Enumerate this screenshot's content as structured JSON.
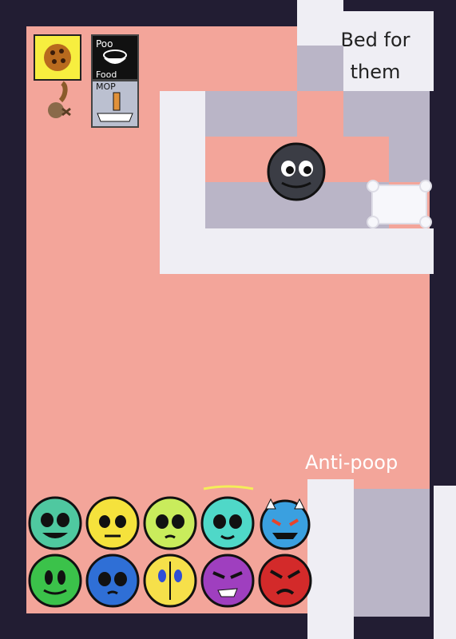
{
  "labels": {
    "bed": "Bed for them",
    "anti_poop": "Anti-poop"
  },
  "inventory": {
    "items": [
      {
        "name": "cookie",
        "icon": "cookie-icon",
        "selected": true
      },
      {
        "name": "poo food",
        "icon": "poo-food-icon",
        "text": "Poo Food"
      },
      {
        "name": "rope",
        "icon": "rope-icon"
      },
      {
        "name": "mop",
        "icon": "mop-icon",
        "text": "MOP"
      }
    ]
  },
  "characters": {
    "main": {
      "icon": "black-blob-character-icon"
    },
    "roster": [
      {
        "icon": "teal-happy-face-icon",
        "color": "#4fc8a0"
      },
      {
        "icon": "yellow-worried-face-icon",
        "color": "#f5e23c"
      },
      {
        "icon": "lime-pleading-face-icon",
        "color": "#c9ec5c"
      },
      {
        "icon": "cyan-halo-face-icon",
        "color": "#4fd8c8"
      },
      {
        "icon": "blue-devil-face-icon",
        "color": "#3aa0e0"
      },
      {
        "icon": "green-calm-face-icon",
        "color": "#3bc24a"
      },
      {
        "icon": "blue-pleading-face-icon",
        "color": "#2f6fd6"
      },
      {
        "icon": "yellow-split-face-icon",
        "color": "#f6e04a"
      },
      {
        "icon": "purple-angry-face-icon",
        "color": "#9f3fbf"
      },
      {
        "icon": "red-angry-face-icon",
        "color": "#d32a2a"
      }
    ]
  },
  "colors": {
    "background": "#221d33",
    "floor": "#f3a59a",
    "wall": "#efeef4",
    "tile": "#bab5c7"
  }
}
